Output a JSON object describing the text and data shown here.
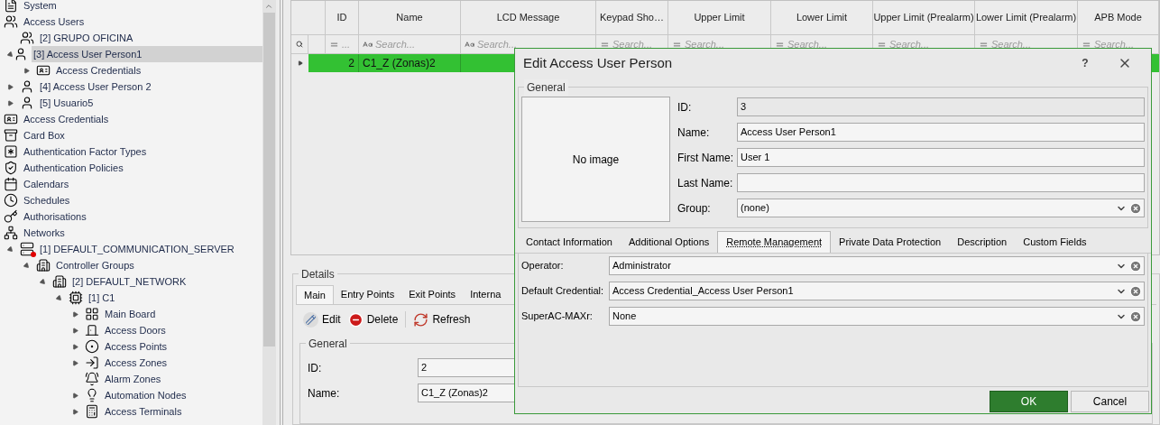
{
  "tree": [
    {
      "label": "System",
      "kind": "system",
      "selected": false
    },
    {
      "label": "Access Users",
      "kind": "users",
      "selected": false,
      "children": [
        {
          "label": "[2] GRUPO OFICINA",
          "kind": "group",
          "selected": false
        },
        {
          "label": "[3] Access User Person1",
          "kind": "person",
          "expanded": true,
          "selected": true,
          "children": [
            {
              "label": "Access Credentials",
              "kind": "credential",
              "expanded": false,
              "selected": false
            }
          ]
        },
        {
          "label": "[4] Access User Person 2",
          "kind": "person",
          "expanded": false,
          "selected": false
        },
        {
          "label": "[5] Usuario5",
          "kind": "person",
          "expanded": false,
          "selected": false
        }
      ]
    },
    {
      "label": "Access Credentials",
      "kind": "credential",
      "selected": false
    },
    {
      "label": "Card Box",
      "kind": "cardbox",
      "selected": false
    },
    {
      "label": "Authentication Factor Types",
      "kind": "factor",
      "selected": false
    },
    {
      "label": "Authentication Policies",
      "kind": "policy",
      "selected": false
    },
    {
      "label": "Calendars",
      "kind": "calendar",
      "selected": false
    },
    {
      "label": "Schedules",
      "kind": "schedule",
      "selected": false
    },
    {
      "label": "Authorisations",
      "kind": "key",
      "selected": false
    },
    {
      "label": "Networks",
      "kind": "network",
      "selected": false,
      "children": [
        {
          "label": "[1] DEFAULT_COMMUNICATION_SERVER",
          "kind": "server",
          "expanded": true,
          "selected": false,
          "children": [
            {
              "label": "Controller Groups",
              "kind": "building",
              "expanded": true,
              "selected": false,
              "children": [
                {
                  "label": "[2] DEFAULT_NETWORK",
                  "kind": "building",
                  "expanded": true,
                  "selected": false,
                  "children": [
                    {
                      "label": "[1] C1",
                      "kind": "controller",
                      "expanded": true,
                      "selected": false,
                      "children": [
                        {
                          "label": "Main Board",
                          "kind": "board",
                          "expanded": false,
                          "selected": false
                        },
                        {
                          "label": "Access Doors",
                          "kind": "door",
                          "expanded": false,
                          "selected": false
                        },
                        {
                          "label": "Access Points",
                          "kind": "point",
                          "expanded": false,
                          "selected": false
                        },
                        {
                          "label": "Access Zones",
                          "kind": "zone",
                          "expanded": false,
                          "selected": false
                        },
                        {
                          "label": "Alarm Zones",
                          "kind": "alarm",
                          "selected": false
                        },
                        {
                          "label": "Automation Nodes",
                          "kind": "bulb",
                          "expanded": false,
                          "selected": false
                        },
                        {
                          "label": "Access Terminals",
                          "kind": "terminal",
                          "expanded": false,
                          "selected": false
                        }
                      ]
                    }
                  ]
                }
              ]
            }
          ]
        }
      ]
    }
  ],
  "grid": {
    "columns": [
      {
        "label": "ID",
        "search": {
          "kind": "number",
          "placeholder": "..."
        }
      },
      {
        "label": "Name",
        "search": {
          "kind": "text",
          "placeholder": "Search..."
        }
      },
      {
        "label": "LCD Message",
        "search": {
          "kind": "text",
          "placeholder": "Search..."
        }
      },
      {
        "label": "Keypad Sho…",
        "search": {
          "kind": "number",
          "placeholder": "Search..."
        }
      },
      {
        "label": "Upper Limit",
        "search": {
          "kind": "number",
          "placeholder": "Search..."
        }
      },
      {
        "label": "Lower Limit",
        "search": {
          "kind": "number",
          "placeholder": "Search..."
        }
      },
      {
        "label": "Upper Limit (Prealarm)",
        "search": {
          "kind": "number",
          "placeholder": "Search..."
        }
      },
      {
        "label": "Lower Limit (Prealarm)",
        "search": {
          "kind": "number",
          "placeholder": "Search..."
        }
      },
      {
        "label": "APB Mode",
        "search": {
          "kind": "number",
          "placeholder": "Search..."
        }
      }
    ],
    "rows": [
      {
        "selected": true,
        "cells": [
          "2",
          "C1_Z (Zonas)2"
        ]
      }
    ]
  },
  "details": {
    "title": "Details",
    "tabs": [
      {
        "label": "Main",
        "selected": true
      },
      {
        "label": "Entry Points",
        "selected": false
      },
      {
        "label": "Exit Points",
        "selected": false
      },
      {
        "label": "Interna",
        "selected": false
      }
    ],
    "toolbar": [
      {
        "kind": "edit",
        "label": "Edit"
      },
      {
        "kind": "delete",
        "label": "Delete"
      },
      {
        "kind": "refresh",
        "label": "Refresh"
      }
    ],
    "general": {
      "title": "General",
      "fields": [
        {
          "label": "ID:",
          "value": "2"
        },
        {
          "label": "Name:",
          "value": "C1_Z (Zonas)2"
        }
      ]
    }
  },
  "dialog": {
    "title": "Edit Access User Person",
    "help": "?",
    "general": {
      "title": "General",
      "image_placeholder": "No image",
      "fields": [
        {
          "label": "ID:",
          "kind": "readonly",
          "value": "3"
        },
        {
          "label": "Name:",
          "kind": "text",
          "value": "Access User Person1"
        },
        {
          "label": "First Name:",
          "kind": "text",
          "value": "User 1"
        },
        {
          "label": "Last Name:",
          "kind": "text"
        },
        {
          "label": "Group:",
          "kind": "combo",
          "value": "(none)"
        }
      ]
    },
    "tabs": [
      {
        "label": "Contact Information",
        "selected": false
      },
      {
        "label": "Additional Options",
        "selected": false
      },
      {
        "label": "Remote Management",
        "selected": true
      },
      {
        "label": "Private Data Protection",
        "selected": false
      },
      {
        "label": "Description",
        "selected": false
      },
      {
        "label": "Custom Fields",
        "selected": false
      }
    ],
    "fields": [
      {
        "label": "Operator:",
        "kind": "combo",
        "value": "Administrator"
      },
      {
        "label": "Default Credential:",
        "kind": "combo",
        "value": "Access Credential_Access User Person1"
      },
      {
        "label": "SuperAC-MAXr:",
        "kind": "combo",
        "value": "None"
      }
    ],
    "buttons": [
      {
        "label": "OK",
        "kind": "primary"
      },
      {
        "label": "Cancel",
        "kind": "secondary"
      }
    ]
  }
}
